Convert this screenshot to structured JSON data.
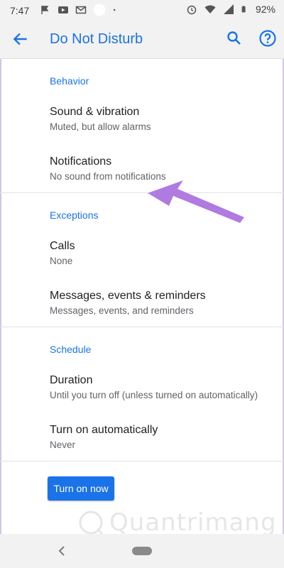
{
  "status_bar": {
    "time": "7:47",
    "battery": "92%"
  },
  "app_bar": {
    "title": "Do Not Disturb"
  },
  "sections": {
    "behavior": {
      "header": "Behavior",
      "sound": {
        "title": "Sound & vibration",
        "subtitle": "Muted, but allow alarms"
      },
      "notifications": {
        "title": "Notifications",
        "subtitle": "No sound from notifications"
      }
    },
    "exceptions": {
      "header": "Exceptions",
      "calls": {
        "title": "Calls",
        "subtitle": "None"
      },
      "messages": {
        "title": "Messages, events & reminders",
        "subtitle": "Messages, events, and reminders"
      }
    },
    "schedule": {
      "header": "Schedule",
      "duration": {
        "title": "Duration",
        "subtitle": "Until you turn off (unless turned on automatically)"
      },
      "auto": {
        "title": "Turn on automatically",
        "subtitle": "Never"
      }
    }
  },
  "button": {
    "label": "Turn on now"
  },
  "watermark": {
    "text": "Quantrimang"
  },
  "colors": {
    "accent": "#1a73e8",
    "arrow": "#b07be0"
  }
}
